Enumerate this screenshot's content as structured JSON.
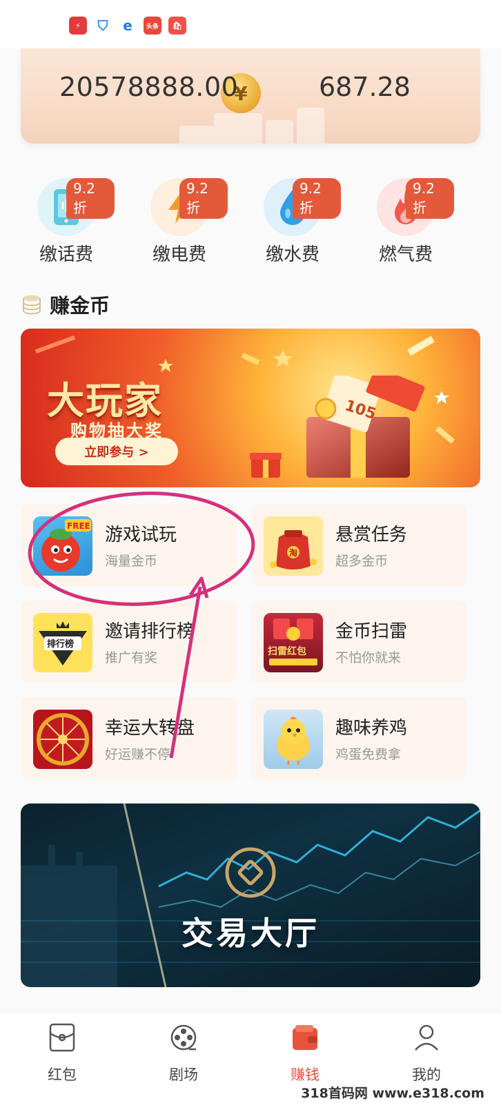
{
  "balance": {
    "amount_left": "20578888.00",
    "amount_right": "687.28"
  },
  "utilities": [
    {
      "label": "缴话费",
      "badge": "9.2折",
      "icon": "phone-icon",
      "color": "#5cc7e0",
      "bg": "#dff4f8"
    },
    {
      "label": "缴电费",
      "badge": "9.2折",
      "icon": "lightning-icon",
      "color": "#f39a2d",
      "bg": "#fdeedd"
    },
    {
      "label": "缴水费",
      "badge": "9.2折",
      "icon": "water-drop-icon",
      "color": "#2ea0e6",
      "bg": "#dff0fb"
    },
    {
      "label": "燃气费",
      "badge": "9.2折",
      "icon": "flame-icon",
      "color": "#f2574f",
      "bg": "#fde4e2"
    }
  ],
  "section": {
    "title": "赚金币"
  },
  "promo": {
    "title": "大玩家",
    "subtitle": "购物抽大奖",
    "button": "立即参与 >"
  },
  "features": [
    {
      "title": "游戏试玩",
      "subtitle": "海量金币",
      "thumb_label": "FREE"
    },
    {
      "title": "悬赏任务",
      "subtitle": "超多金币",
      "thumb_label": ""
    },
    {
      "title": "邀请排行榜",
      "subtitle": "推广有奖",
      "thumb_label": "排行榜"
    },
    {
      "title": "金币扫雷",
      "subtitle": "不怕你就来",
      "thumb_label": "扫雷红包"
    },
    {
      "title": "幸运大转盘",
      "subtitle": "好运赚不停",
      "thumb_label": ""
    },
    {
      "title": "趣味养鸡",
      "subtitle": "鸡蛋免费拿",
      "thumb_label": ""
    }
  ],
  "trade": {
    "title": "交易大厅"
  },
  "nav": [
    {
      "label": "红包",
      "icon": "red-envelope-icon",
      "active": false
    },
    {
      "label": "剧场",
      "icon": "film-reel-icon",
      "active": false
    },
    {
      "label": "赚钱",
      "icon": "wallet-icon",
      "active": true
    },
    {
      "label": "我的",
      "icon": "user-icon",
      "active": false
    }
  ],
  "status_icons": [
    "app-icon-red",
    "shield-icon",
    "browser-icon",
    "toutiao-icon",
    "shop-icon"
  ],
  "watermark": "318首码网 www.e318.com",
  "colors": {
    "accent": "#e5533c",
    "badge": "#e35a3a",
    "annotation": "#d6307a"
  }
}
